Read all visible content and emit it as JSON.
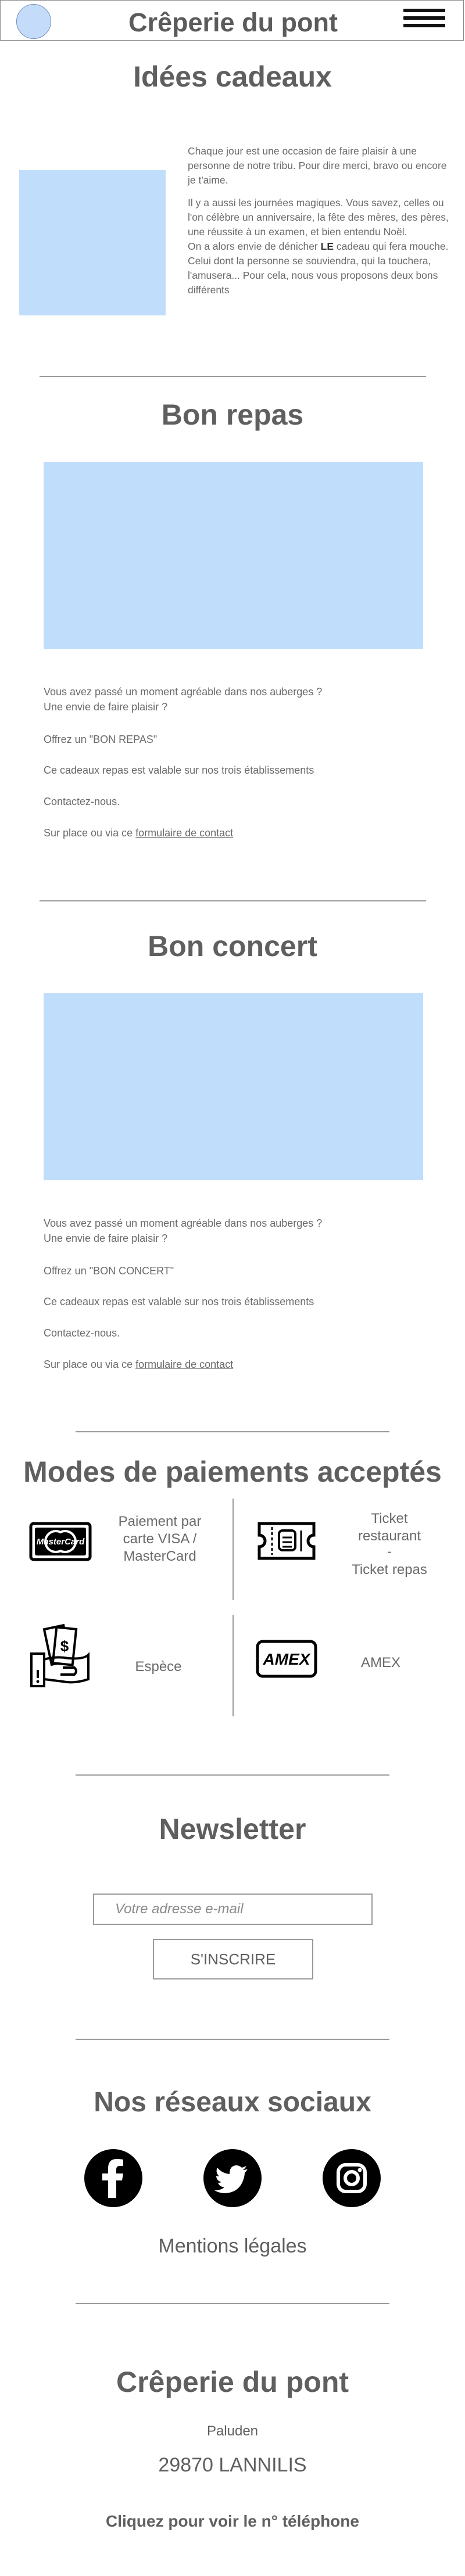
{
  "header": {
    "title": "Crêperie du pont"
  },
  "gifts": {
    "title": "Idées cadeaux",
    "p1": "Chaque jour est une occasion de faire plaisir à une personne de notre tribu. Pour dire merci, bravo ou encore je t'aime.",
    "p2": "Il y a aussi les journées magiques. Vous savez, celles ou l'on célèbre un anniversaire, la fête des mères, des pères, une réussite à un examen, et bien entendu Noël.",
    "p3a": "On a alors envie de dénicher ",
    "p3b": "LE",
    "p3c": " cadeau qui fera mouche. Celui dont la personne se souviendra, qui la touchera, l'amusera... Pour cela, nous vous proposons deux bons différents"
  },
  "repas": {
    "title": "Bon repas",
    "l1": "Vous avez passé un moment agréable dans nos auberges ?",
    "l2": "Une envie de faire plaisir ?",
    "l3": "Offrez un \"BON REPAS\"",
    "l4": "Ce cadeaux repas est valable sur nos trois établissements",
    "l5": "Contactez-nous.",
    "l6": "Sur place ou via ce ",
    "link": "formulaire de contact"
  },
  "concert": {
    "title": "Bon concert",
    "l1": "Vous avez passé un moment agréable dans nos auberges ?",
    "l2": "Une envie de faire plaisir ?",
    "l3": "Offrez un \"BON CONCERT\"",
    "l4": "Ce cadeaux repas est valable sur nos trois établissements",
    "l5": "Contactez-nous.",
    "l6": "Sur place ou via ce ",
    "link": "formulaire de contact"
  },
  "payments": {
    "title": "Modes de paiements acceptés",
    "card": "Paiement par carte VISA / MasterCard",
    "card_logo": "MasterCard",
    "ticket1": "Ticket restaurant",
    "ticket_sep": "-",
    "ticket2": "Ticket repas",
    "cash": "Espèce",
    "amex": "AMEX",
    "amex_logo": "AMEX"
  },
  "newsletter": {
    "title": "Newsletter",
    "placeholder": "Votre adresse e-mail",
    "button": "S'INSCRIRE"
  },
  "social": {
    "title": "Nos réseaux sociaux",
    "icons": [
      "facebook-icon",
      "twitter-icon",
      "instagram-icon"
    ],
    "legal": "Mentions légales"
  },
  "footer": {
    "name": "Crêperie du pont",
    "place": "Paluden",
    "city": "29870 LANNILIS",
    "phone": "Cliquez pour voir le n° téléphone"
  },
  "colors": {
    "placeholder_blue": "#c0ddfb",
    "text": "#5f5f5f"
  }
}
